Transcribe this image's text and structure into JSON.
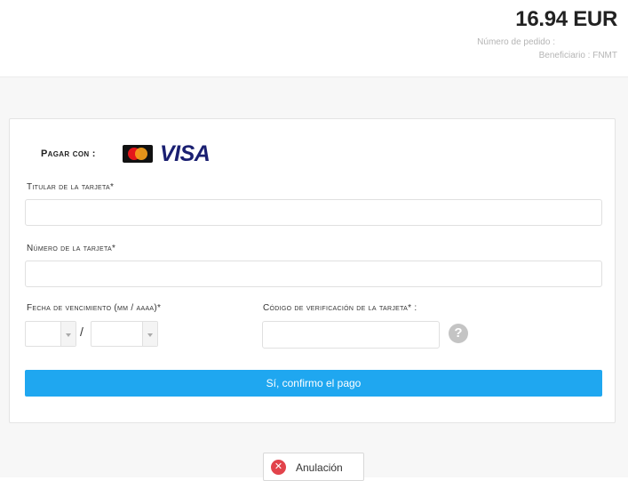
{
  "header": {
    "amount": "16.94 EUR",
    "order_number_label": "Número de pedido :",
    "beneficiary": "Beneficiario : FNMT"
  },
  "payment": {
    "pay_with_label": "Pagar con :",
    "card_brands": [
      "mastercard-icon",
      "visa-logo"
    ],
    "visa_text": "VISA"
  },
  "form": {
    "cardholder_label": "Titular de la tarjeta*",
    "cardholder_value": "",
    "card_number_label": "Número de la tarjeta*",
    "card_number_value": "",
    "expiry_label": "Fecha de vencimiento (mm / aaaa)*",
    "expiry_month_value": "",
    "expiry_separator": "/",
    "expiry_year_value": "",
    "cvv_label": "Código de verificación de la tarjeta* :",
    "cvv_value": "",
    "help_icon_glyph": "?"
  },
  "actions": {
    "confirm_label": "Sí, confirmo el pago",
    "cancel_label": "Anulación",
    "cancel_icon_glyph": "✕"
  },
  "colors": {
    "accent": "#1fa7f0",
    "cancel_icon": "#e2434b",
    "visa_blue": "#1a1f71"
  }
}
